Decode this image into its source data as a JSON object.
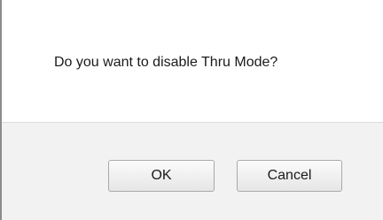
{
  "dialog": {
    "message": "Do you want to disable Thru Mode?",
    "ok_label": "OK",
    "cancel_label": "Cancel"
  }
}
